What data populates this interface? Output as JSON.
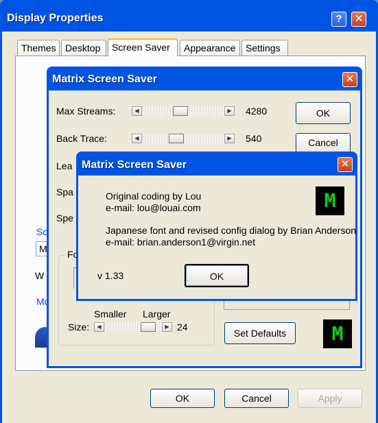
{
  "display_properties": {
    "title": "Display Properties",
    "help_glyph": "?",
    "close_glyph": "✕",
    "tabs": [
      {
        "label": "Themes"
      },
      {
        "label": "Desktop"
      },
      {
        "label": "Screen Saver"
      },
      {
        "label": "Appearance"
      },
      {
        "label": "Settings"
      }
    ],
    "partial_labels": {
      "sc": "Sc",
      "m": "M",
      "w": "W",
      "mo": "Mo"
    },
    "buttons": {
      "ok": "OK",
      "cancel": "Cancel",
      "apply": "Apply"
    }
  },
  "matrix_config": {
    "title": "Matrix Screen Saver",
    "close_glyph": "✕",
    "sliders": {
      "max_streams": {
        "label": "Max Streams:",
        "value": "4280",
        "fraction": 0.55
      },
      "back_trace": {
        "label": "Back Trace:",
        "value": "540",
        "fraction": 0.48
      }
    },
    "partial_labels": {
      "lead": "Lea",
      "spa1": "Spa",
      "spe": "Spe",
      "fo": "Fo"
    },
    "font_size": {
      "smaller": "Smaller",
      "larger": "Larger",
      "label": "Size:",
      "value": "24"
    },
    "buttons": {
      "ok": "OK",
      "cancel": "Cancel",
      "set_defaults": "Set Defaults"
    },
    "logo_letter": "M"
  },
  "about_dialog": {
    "title": "Matrix Screen Saver",
    "close_glyph": "✕",
    "line1": "Original coding by Lou",
    "line2": "e-mail: lou@louai.com",
    "line3": "Japanese font and revised config dialog by Brian Anderson",
    "line4": "e-mail: brian.anderson1@virgin.net",
    "version": "v 1.33",
    "ok_label": "OK",
    "logo_letter": "M"
  },
  "colors": {
    "xp_blue": "#0054e3",
    "close_red": "#c4411c",
    "tab_highlight": "#f7b438",
    "matrix_green": "#11d011"
  }
}
